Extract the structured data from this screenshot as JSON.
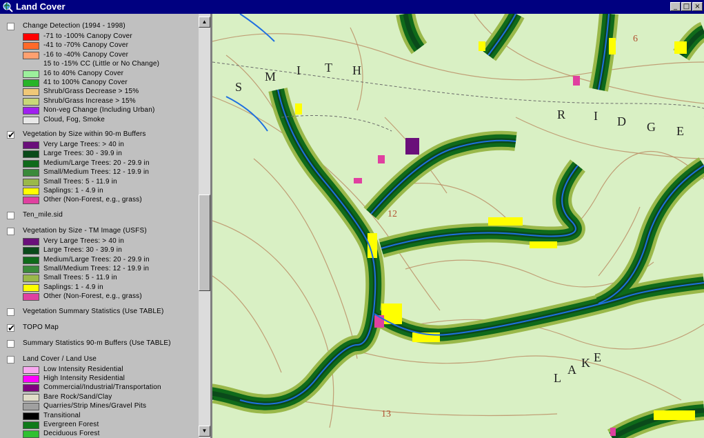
{
  "window": {
    "title": "Land Cover"
  },
  "titlebar_buttons": [
    {
      "name": "minimize-button",
      "glyph": "_"
    },
    {
      "name": "maximize-button",
      "glyph": "□"
    },
    {
      "name": "close-button",
      "glyph": "×"
    }
  ],
  "scrollbar": {
    "up_glyph": "▲",
    "down_glyph": "▼"
  },
  "toc": {
    "layers": [
      {
        "name": "Change Detection (1994 - 1998)",
        "checked": false,
        "legend": [
          {
            "label": "-71 to -100% Canopy Cover",
            "color": "#ff0000"
          },
          {
            "label": "-41 to -70% Canopy Cover",
            "color": "#ff6a2a"
          },
          {
            "label": "-16 to -40% Canopy Cover",
            "color": "#ffa070"
          },
          {
            "label": "15 to -15% CC (Little or No Change)",
            "color": "none"
          },
          {
            "label": "16 to 40% Canopy Cover",
            "color": "#9cf09c"
          },
          {
            "label": "41 to 100% Canopy Cover",
            "color": "#28b428"
          },
          {
            "label": "Shrub/Grass Decrease > 15%",
            "color": "#f0c878"
          },
          {
            "label": "Shrub/Grass Increase > 15%",
            "color": "#c8d878"
          },
          {
            "label": "Non-veg Change (Including Urban)",
            "color": "#a020f0"
          },
          {
            "label": "Cloud, Fog, Smoke",
            "color": "#e8e8e8"
          }
        ]
      },
      {
        "name": "Vegetation by Size within 90-m Buffers",
        "checked": true,
        "legend": [
          {
            "label": "Very Large Trees: > 40  in",
            "color": "#6a0f7a"
          },
          {
            "label": "Large Trees: 30 - 39.9 in",
            "color": "#0a4a1a"
          },
          {
            "label": "Medium/Large Trees: 20 - 29.9 in",
            "color": "#0f6a1a"
          },
          {
            "label": "Small/Medium Trees: 12 - 19.9 in",
            "color": "#3a8a3a"
          },
          {
            "label": "Small Trees: 5 - 11.9 in",
            "color": "#9ab84a"
          },
          {
            "label": "Saplings: 1 - 4.9 in",
            "color": "#ffff00"
          },
          {
            "label": "Other (Non-Forest, e.g., grass)",
            "color": "#e040a0"
          }
        ]
      },
      {
        "name": "Ten_mile.sid",
        "checked": false,
        "legend": []
      },
      {
        "name": "Vegetation by Size - TM Image (USFS)",
        "checked": false,
        "legend": [
          {
            "label": "Very Large Trees: > 40  in",
            "color": "#6a0f7a"
          },
          {
            "label": "Large Trees: 30 - 39.9 in",
            "color": "#0a4a1a"
          },
          {
            "label": "Medium/Large Trees: 20 - 29.9 in",
            "color": "#0f6a1a"
          },
          {
            "label": "Small/Medium Trees: 12 - 19.9 in",
            "color": "#3a8a3a"
          },
          {
            "label": "Small Trees: 5 - 11.9 in",
            "color": "#9ab84a"
          },
          {
            "label": "Saplings: 1 - 4.9 in",
            "color": "#ffff00"
          },
          {
            "label": "Other (Non-Forest, e.g., grass)",
            "color": "#e040a0"
          }
        ]
      },
      {
        "name": "Vegetation Summary Statistics (Use TABLE)",
        "checked": false,
        "legend": []
      },
      {
        "name": "TOPO Map",
        "checked": true,
        "legend": []
      },
      {
        "name": "Summary Statistics 90-m Buffers (Use TABLE)",
        "checked": false,
        "legend": []
      },
      {
        "name": "Land Cover / Land Use",
        "checked": false,
        "legend": [
          {
            "label": "Low Intensity Residential",
            "color": "#f8a8f0"
          },
          {
            "label": "High Intensity Residential",
            "color": "#ff00ff"
          },
          {
            "label": "Commercial/Industrial/Transportation",
            "color": "#800080"
          },
          {
            "label": "Bare Rock/Sand/Clay",
            "color": "#e0dcc8"
          },
          {
            "label": "Quarries/Strip Mines/Gravel Pits",
            "color": "#a0a0a0"
          },
          {
            "label": "Transitional",
            "color": "#000000"
          },
          {
            "label": "Evergreen Forest",
            "color": "#0f7a1a"
          },
          {
            "label": "Deciduous Forest",
            "color": "#30c030"
          }
        ]
      }
    ]
  },
  "map": {
    "labels": [
      "S",
      "M",
      "I",
      "T",
      "H",
      "R",
      "I",
      "D",
      "G",
      "E",
      "L",
      "A",
      "K",
      "E"
    ],
    "section_numbers": [
      "12",
      "13",
      "6"
    ],
    "colors": {
      "base": "#d9f0c4",
      "contour": "#b98a62",
      "stream": "#1e6fe0",
      "outer": "#9ab84a",
      "mid": "#0f6a1a",
      "inner": "#0a4a1a",
      "sapling": "#ffff00",
      "other": "#e040a0",
      "verylarge": "#6a0f7a"
    }
  }
}
